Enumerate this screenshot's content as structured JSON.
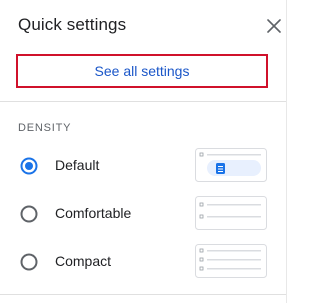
{
  "panel": {
    "title": "Quick settings",
    "close_icon": "close-icon",
    "see_all_label": "See all settings"
  },
  "density": {
    "section_label": "DENSITY",
    "selected": "Default",
    "options": [
      {
        "label": "Default",
        "selected": true,
        "thumbnail": "density-default-preview"
      },
      {
        "label": "Comfortable",
        "selected": false,
        "thumbnail": "density-comfortable-preview"
      },
      {
        "label": "Compact",
        "selected": false,
        "thumbnail": "density-compact-preview"
      }
    ]
  },
  "colors": {
    "accent": "#1a73e8",
    "link": "#1a56c8",
    "highlight_border": "#d0112b"
  }
}
